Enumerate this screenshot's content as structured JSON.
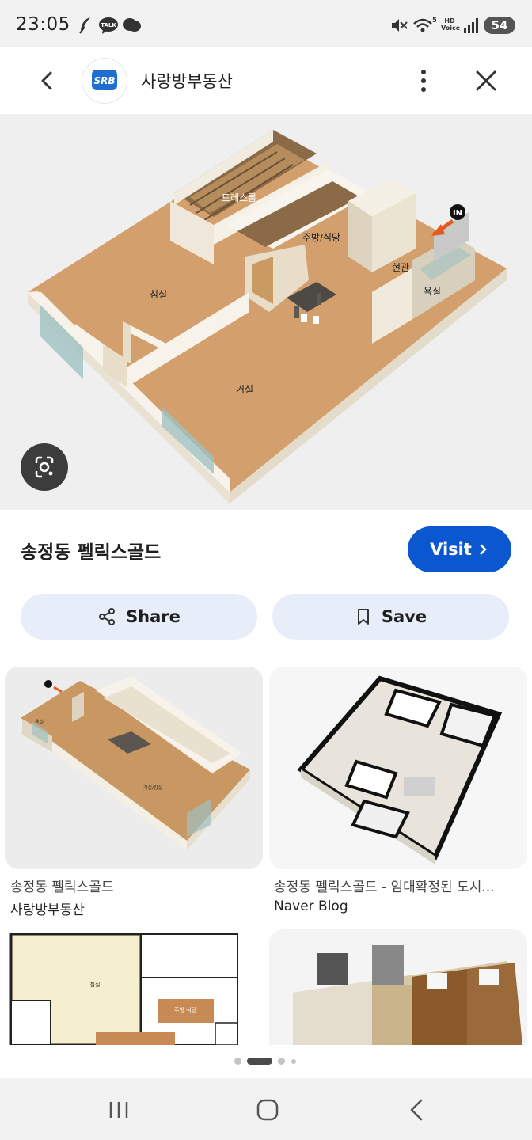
{
  "status_bar": {
    "time": "23:05",
    "battery": "54",
    "network_label": "HD Voice"
  },
  "header": {
    "site_name": "사랑방부동산",
    "logo_text": "SRB"
  },
  "hero": {
    "rooms": {
      "dress": "드레스룸",
      "kitchen": "주방/식당",
      "bed": "침실",
      "entry": "현관",
      "bath": "욕실",
      "living": "거실",
      "in_sign": "IN"
    }
  },
  "result": {
    "title": "송정동 펠릭스골드",
    "visit_label": "Visit",
    "share_label": "Share",
    "save_label": "Save"
  },
  "related": [
    {
      "title": "송정동 펠릭스골드",
      "source": "사랑방부동산"
    },
    {
      "title": "송정동 펠릭스골드 - 임대확정된 도시...",
      "source": "Naver Blog"
    },
    {
      "title": "",
      "source": ""
    },
    {
      "title": "",
      "source": ""
    }
  ],
  "thumb_labels": {
    "bed": "침실",
    "kitchen": "주방\n식당",
    "bath": "욕실",
    "living": "거실/침실"
  },
  "pager": {
    "pages": 5,
    "active": 1
  }
}
